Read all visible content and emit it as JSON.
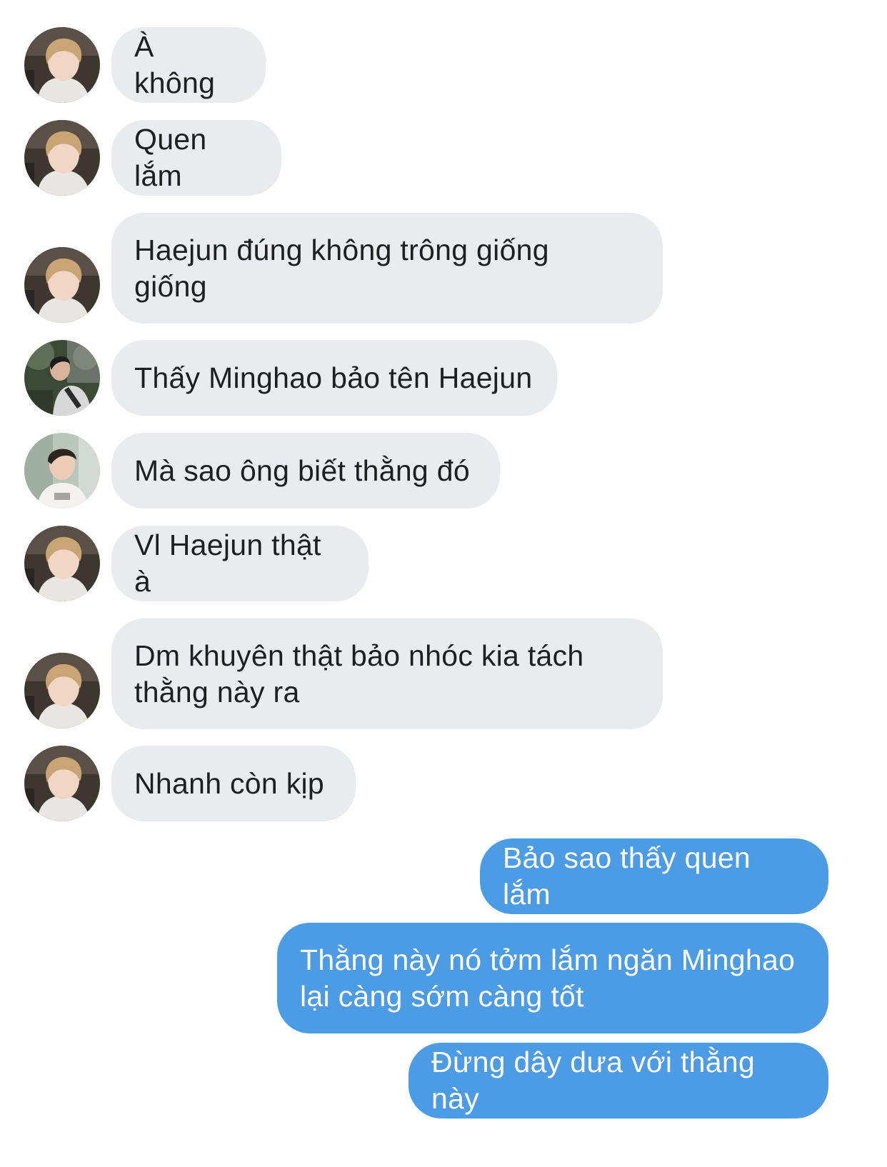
{
  "avatars": {
    "friend_a": "avatar-blond-guy",
    "friend_b": "avatar-dark-outdoor",
    "friend_c": "avatar-white-shirt"
  },
  "colors": {
    "incoming_bg": "#e9ebef",
    "outgoing_bg": "#4c9be5",
    "incoming_text": "#1f1f1f",
    "outgoing_text": "#ffffff"
  },
  "messages": [
    {
      "text": "À không",
      "sender": "friend_a",
      "direction": "incoming"
    },
    {
      "text": "Quen lắm",
      "sender": "friend_a",
      "direction": "incoming"
    },
    {
      "text": "Haejun đúng không trông giống giống",
      "sender": "friend_a",
      "direction": "incoming"
    },
    {
      "text": "Thấy Minghao bảo tên Haejun",
      "sender": "friend_b",
      "direction": "incoming"
    },
    {
      "text": "Mà sao ông biết thằng đó",
      "sender": "friend_c",
      "direction": "incoming"
    },
    {
      "text": "Vl Haejun thật à",
      "sender": "friend_a",
      "direction": "incoming"
    },
    {
      "text": "Dm khuyên thật bảo nhóc kia tách thằng này ra",
      "sender": "friend_a",
      "direction": "incoming"
    },
    {
      "text": "Nhanh còn kịp",
      "sender": "friend_a",
      "direction": "incoming"
    },
    {
      "text": "Bảo sao thấy quen lắm",
      "direction": "outgoing"
    },
    {
      "text": "Thằng này nó tởm lắm ngăn Minghao lại càng sớm càng tốt",
      "direction": "outgoing"
    },
    {
      "text": "Đừng dây dưa với thằng này",
      "direction": "outgoing"
    }
  ]
}
